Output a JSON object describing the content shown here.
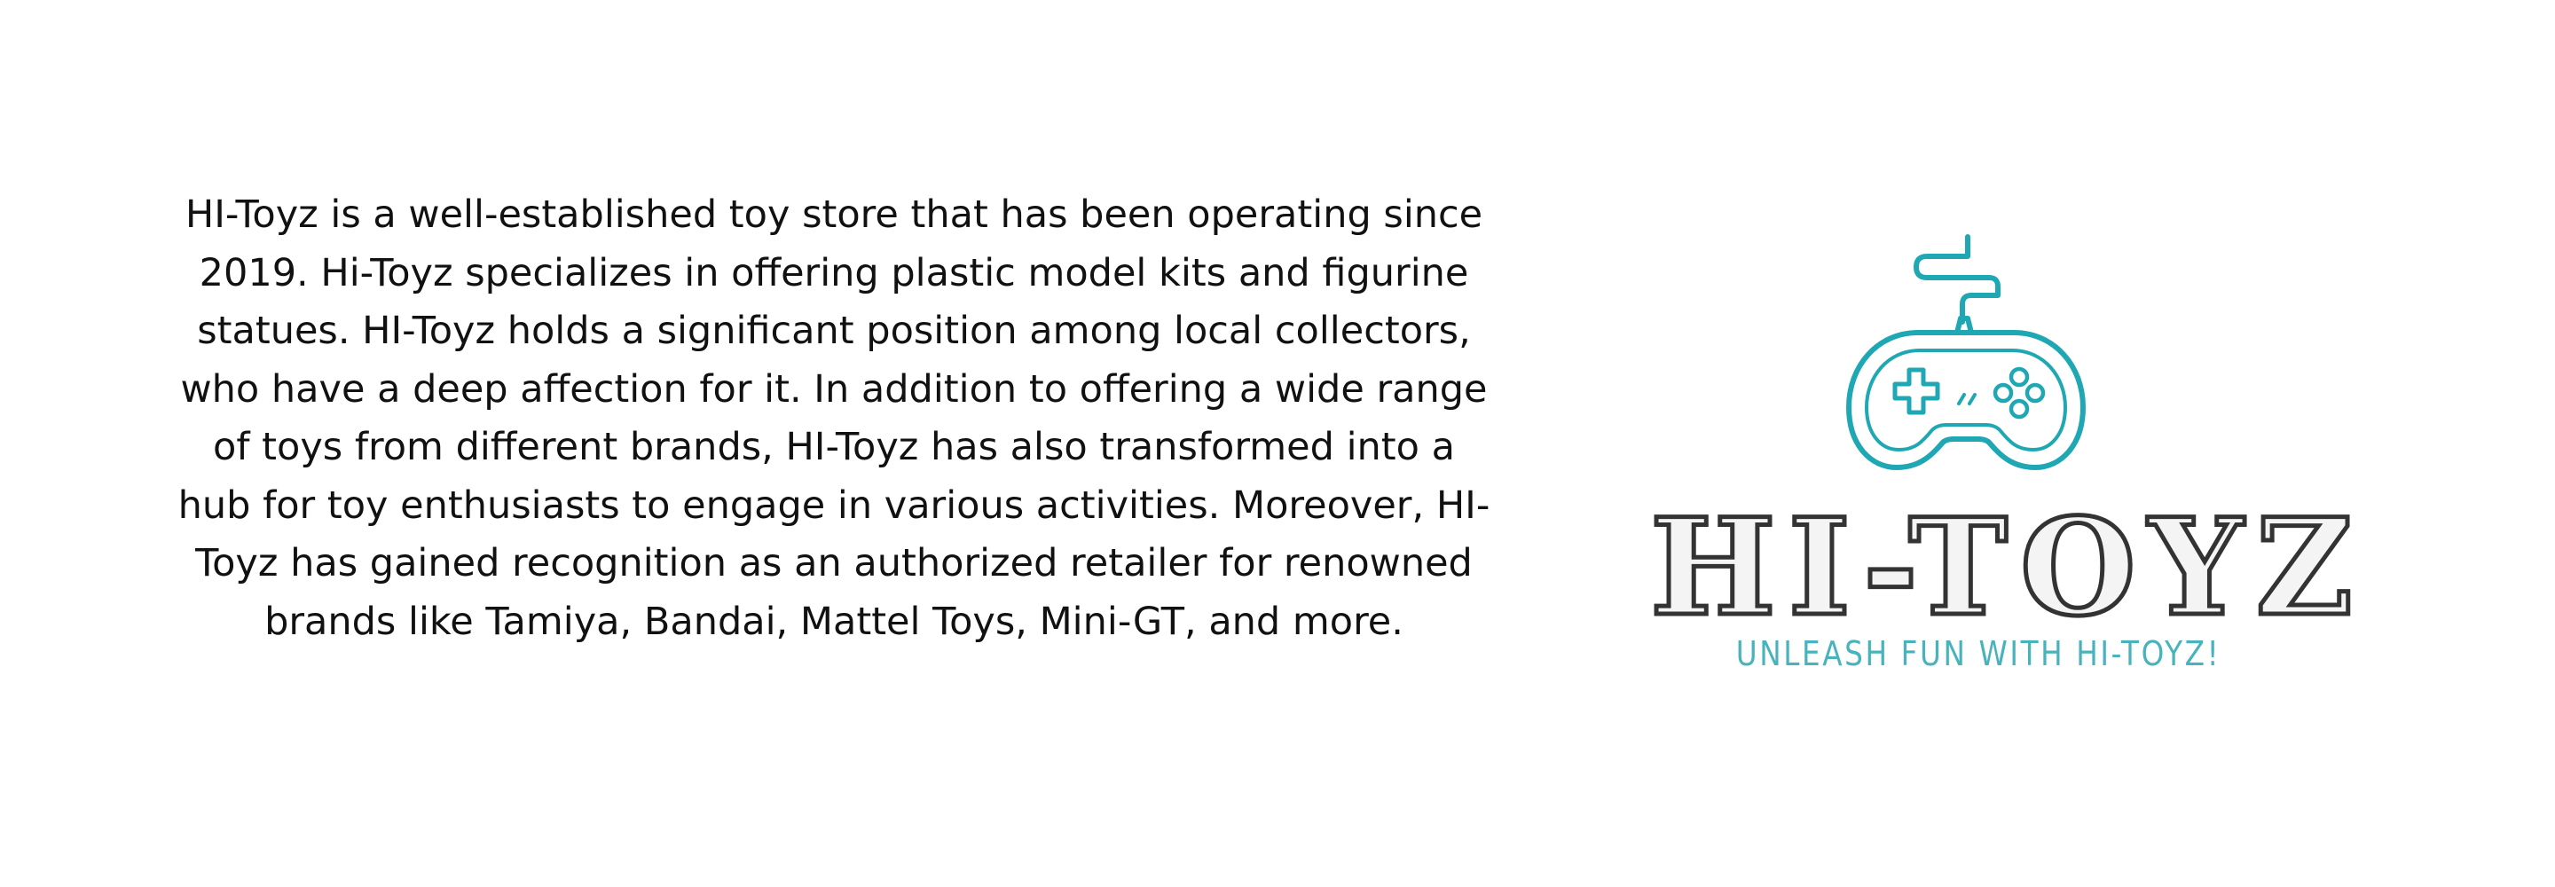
{
  "about": {
    "paragraph": "HI-Toyz is a well-established toy store that has been operating since 2019. Hi-Toyz specializes in offering plastic model kits and figurine statues. HI-Toyz holds a significant position among local collectors, who have a deep affection for it. In addition to offering a wide range of toys from different brands, HI-Toyz has also transformed into a hub for toy enthusiasts to engage in various activities. Moreover, HI-Toyz has gained recognition as an authorized retailer for renowned brands like Tamiya, Bandai, Mattel Toys, Mini-GT, and more."
  },
  "logo": {
    "icon": "game-controller-icon",
    "wordmark": "HI-TOYZ",
    "tagline": "UNLEASH FUN WITH HI-TOYZ!",
    "colors": {
      "accent": "#1fa8b4",
      "tagline": "#48b3bd",
      "wordmark": "#333333",
      "text": "#111111"
    }
  }
}
